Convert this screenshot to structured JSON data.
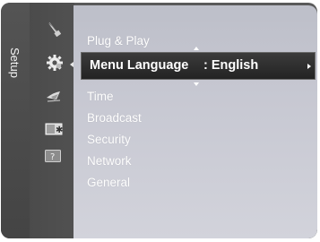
{
  "menu": {
    "section_title": "Setup",
    "items": [
      {
        "label": "Plug & Play"
      },
      {
        "label": "Menu Language",
        "value": ": English"
      },
      {
        "label": "Time"
      },
      {
        "label": "Broadcast"
      },
      {
        "label": "Security"
      },
      {
        "label": "Network"
      },
      {
        "label": "General"
      }
    ],
    "help_icon_glyph": "?"
  },
  "icons": [
    "picture-icon",
    "setup-gear-icon",
    "satellite-dish-icon",
    "channel-icon",
    "support-question-icon"
  ],
  "colors": {
    "panel_bg": "#c7c8d2",
    "selection_bg": "#2a2a2a",
    "sidebar_bg": "#4b4b4b",
    "text": "#ffffff"
  }
}
